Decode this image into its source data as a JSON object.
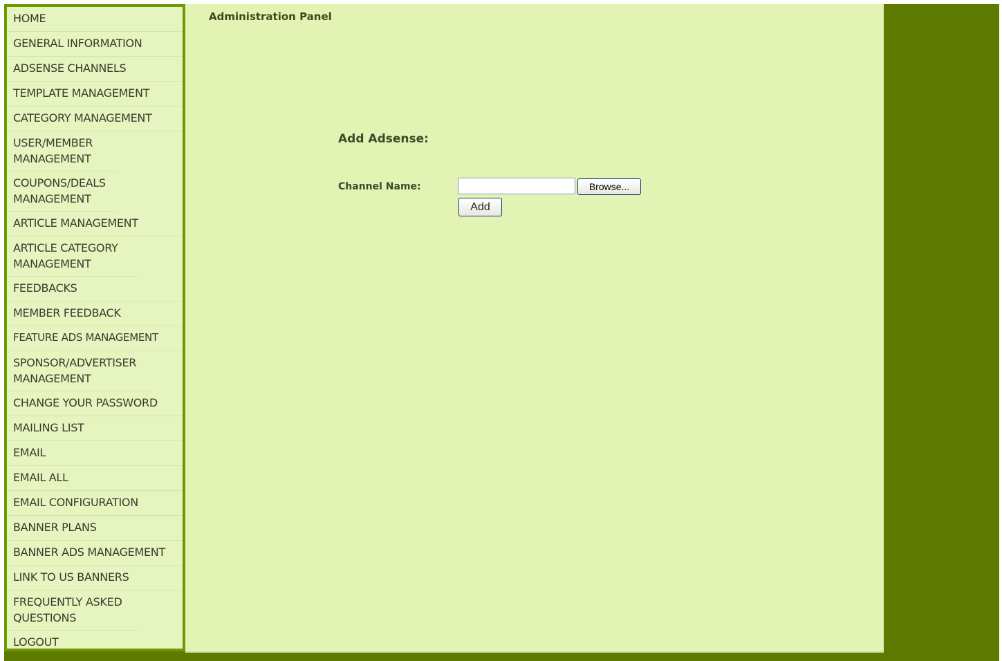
{
  "header": {
    "title": "Administration Panel"
  },
  "sidebar": {
    "items": [
      {
        "label": "HOME"
      },
      {
        "label": "GENERAL INFORMATION"
      },
      {
        "label": "ADSENSE CHANNELS"
      },
      {
        "label": "TEMPLATE MANAGEMENT"
      },
      {
        "label": "CATEGORY MANAGEMENT"
      },
      {
        "label": "USER/MEMBER MANAGEMENT"
      },
      {
        "label": "COUPONS/DEALS MANAGEMENT"
      },
      {
        "label": "ARTICLE MANAGEMENT"
      },
      {
        "label": "ARTICLE CATEGORY MANAGEMENT"
      },
      {
        "label": "FEEDBACKS"
      },
      {
        "label": "MEMBER FEEDBACK"
      },
      {
        "label": "FEATURE ADS MANAGEMENT"
      },
      {
        "label": "SPONSOR/ADVERTISER MANAGEMENT"
      },
      {
        "label": "CHANGE YOUR PASSWORD"
      },
      {
        "label": "MAILING LIST"
      },
      {
        "label": "EMAIL"
      },
      {
        "label": "EMAIL ALL"
      },
      {
        "label": "EMAIL CONFIGURATION"
      },
      {
        "label": "BANNER PLANS"
      },
      {
        "label": "BANNER ADS MANAGEMENT"
      },
      {
        "label": "LINK TO US BANNERS"
      },
      {
        "label": "FREQUENTLY ASKED QUESTIONS"
      },
      {
        "label": "LOGOUT"
      }
    ]
  },
  "form": {
    "title": "Add Adsense:",
    "channel_name_label": "Channel Name:",
    "channel_name_value": "",
    "browse_label": "Browse...",
    "add_label": "Add"
  },
  "colors": {
    "page_background": "#5e7a00",
    "sidebar_background": "#e6f5c0",
    "sidebar_border": "#6e9900",
    "content_background": "#e2f3b4"
  }
}
